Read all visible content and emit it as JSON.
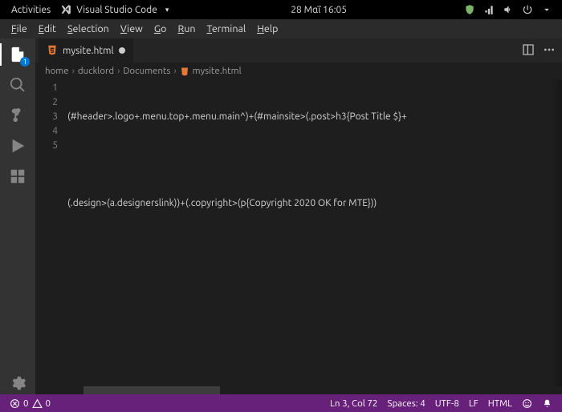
{
  "topbar": {
    "activities": "Activities",
    "app_name": "Visual Studio Code",
    "clock": "28 Μαΐ  16:05"
  },
  "menu": {
    "file": {
      "label": "File",
      "accel": "F"
    },
    "edit": {
      "label": "Edit",
      "accel": "E"
    },
    "selection": {
      "label": "Selection",
      "accel": "S"
    },
    "view": {
      "label": "View",
      "accel": "V"
    },
    "go": {
      "label": "Go",
      "accel": "G"
    },
    "run": {
      "label": "Run",
      "accel": "R"
    },
    "terminal": {
      "label": "Terminal",
      "accel": "T"
    },
    "help": {
      "label": "Help",
      "accel": "H"
    }
  },
  "activity": {
    "explorer_badge": "1"
  },
  "tab": {
    "filename": "mysite.html"
  },
  "breadcrumb": {
    "seg0": "home",
    "seg1": "ducklord",
    "seg2": "Documents",
    "seg3": "mysite.html"
  },
  "editor": {
    "line_numbers": {
      "l1": "1",
      "l2": "2",
      "l3": "3",
      "l4": "4",
      "l5": "5"
    },
    "lines": {
      "l1": "(#header>.logo+.menu.top+.menu.main^)+(#mainsite>(.post>h3{Post Title $}+",
      "l2": "",
      "l3": "(.design>(a.designerslink))+(.copyright>(p{Copyright 2020 OK for MTE}))",
      "l4": "",
      "l5": ""
    }
  },
  "status": {
    "errors": "0",
    "warnings": "0",
    "lncol": "Ln 3, Col 72",
    "spaces": "Spaces: 4",
    "encoding": "UTF-8",
    "eol": "LF",
    "language": "HTML"
  }
}
